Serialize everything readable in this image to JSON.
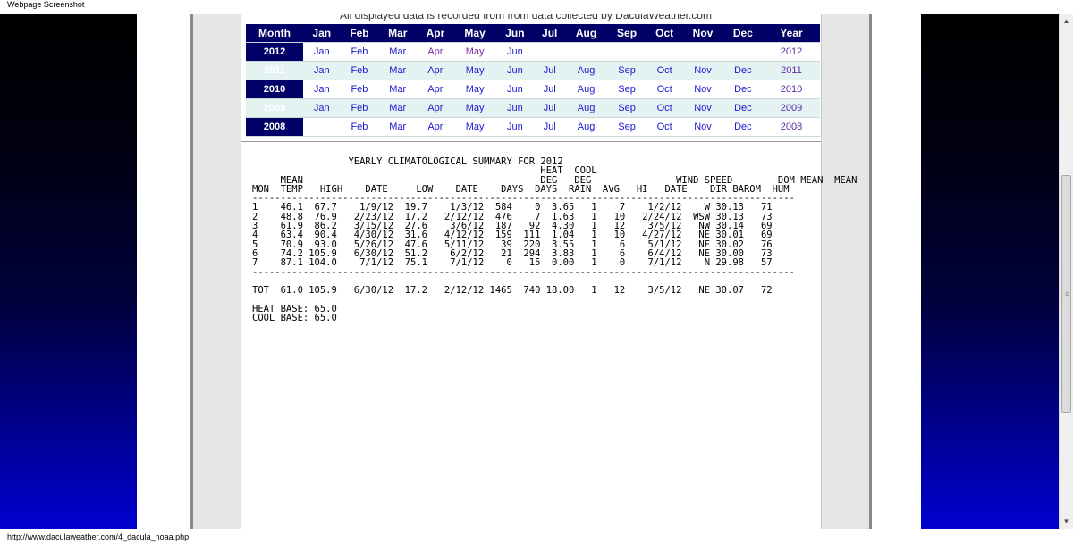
{
  "window": {
    "title": "Webpage Screenshot",
    "status_url": "http://www.daculaweather.com/4_dacula_noaa.php"
  },
  "notice": "All displayed data is recorded from from data collected by DaculaWeather.com",
  "month_table": {
    "header": {
      "month_label": "Month",
      "months": [
        "Jan",
        "Feb",
        "Mar",
        "Apr",
        "May",
        "Jun",
        "Jul",
        "Aug",
        "Sep",
        "Oct",
        "Nov",
        "Dec"
      ],
      "year_label": "Year"
    },
    "rows": [
      {
        "year": "2012",
        "links": [
          "Jan",
          "Feb",
          "Mar",
          "Apr",
          "May",
          "Jun",
          "",
          "",
          "",
          "",
          "",
          ""
        ]
      },
      {
        "year": "2011",
        "links": [
          "Jan",
          "Feb",
          "Mar",
          "Apr",
          "May",
          "Jun",
          "Jul",
          "Aug",
          "Sep",
          "Oct",
          "Nov",
          "Dec"
        ]
      },
      {
        "year": "2010",
        "links": [
          "Jan",
          "Feb",
          "Mar",
          "Apr",
          "May",
          "Jun",
          "Jul",
          "Aug",
          "Sep",
          "Oct",
          "Nov",
          "Dec"
        ]
      },
      {
        "year": "2009",
        "links": [
          "Jan",
          "Feb",
          "Mar",
          "Apr",
          "May",
          "Jun",
          "Jul",
          "Aug",
          "Sep",
          "Oct",
          "Nov",
          "Dec"
        ]
      },
      {
        "year": "2008",
        "links": [
          "",
          "Feb",
          "Mar",
          "Apr",
          "May",
          "Jun",
          "Jul",
          "Aug",
          "Sep",
          "Oct",
          "Nov",
          "Dec"
        ]
      }
    ]
  },
  "summary": {
    "title": "                 YEARLY CLIMATOLOGICAL SUMMARY FOR 2012",
    "header_lines": [
      "                                                   HEAT  COOL",
      "     MEAN                                          DEG   DEG               WIND SPEED        DOM MEAN  MEAN",
      "MON  TEMP   HIGH    DATE     LOW    DATE    DAYS  DAYS  RAIN  AVG   HI   DATE    DIR BAROM  HUM",
      "------------------------------------------------------------------------------------------------"
    ],
    "rows": [
      "1    46.1  67.7    1/9/12  19.7    1/3/12  584    0  3.65   1    7    1/2/12    W 30.13   71",
      "2    48.8  76.9   2/23/12  17.2   2/12/12  476    7  1.63   1   10   2/24/12  WSW 30.13   73",
      "3    61.9  86.2   3/15/12  27.6    3/6/12  187   92  4.30   1   12    3/5/12   NW 30.14   69",
      "4    63.4  90.4   4/30/12  31.6   4/12/12  159  111  1.04   1   10   4/27/12   NE 30.01   69",
      "5    70.9  93.0   5/26/12  47.6   5/11/12   39  220  3.55   1    6    5/1/12   NE 30.02   76",
      "6    74.2 105.9   6/30/12  51.2    6/2/12   21  294  3.83   1    6    6/4/12   NE 30.00   73",
      "7    87.1 104.0    7/1/12  75.1    7/1/12    0   15  0.00   1    0    7/1/12    N 29.98   57"
    ],
    "separator": "------------------------------------------------------------------------------------------------",
    "total": "TOT  61.0 105.9   6/30/12  17.2   2/12/12 1465  740 18.00   1   12    3/5/12   NE 30.07   72",
    "footer": [
      "HEAT BASE: 65.0",
      "COOL BASE: 65.0"
    ]
  }
}
